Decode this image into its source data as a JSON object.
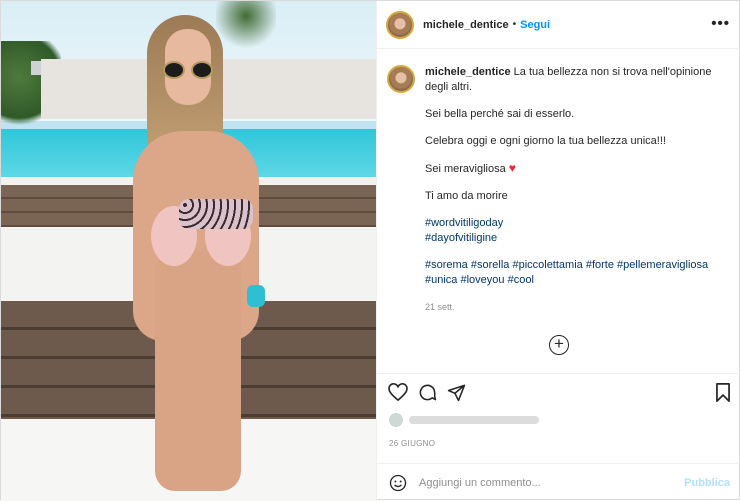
{
  "post": {
    "username": "michele_dentice",
    "separator": "•",
    "follow_label": "Segui",
    "more_label": "•••"
  },
  "caption": {
    "username": "michele_dentice",
    "line1": "La tua bellezza non si trova nell'opinione degli altri.",
    "line2": "Sei bella perché sai di esserlo.",
    "line3": "Celebra oggi e ogni giorno la tua bellezza unica!!!",
    "line4": "Sei meravigliosa",
    "heart": "♥",
    "line5": "Ti amo da morire",
    "tags_a": [
      "#wordvitiligoday",
      "#dayofvitiligine"
    ],
    "tags_b": [
      "#sorema",
      "#sorella",
      "#piccolettamia",
      "#forte",
      "#pellemeravigliosa",
      "#unica",
      "#loveyou",
      "#cool"
    ],
    "time": "21 sett."
  },
  "actions": {
    "like_icon": "heart-outline-icon",
    "comment_icon": "comment-icon",
    "share_icon": "paper-plane-icon",
    "save_icon": "bookmark-icon",
    "more_comments_icon": "plus-circle-icon"
  },
  "post_date": "26 GIUGNO",
  "comment_box": {
    "placeholder": "Aggiungi un commento...",
    "publish_label": "Pubblica",
    "emoji_icon": "emoji-icon"
  },
  "colors": {
    "link": "#0095f6",
    "hashtag": "#00376b",
    "heart": "#ed2a3a",
    "publish_disabled": "#b2dffc"
  }
}
